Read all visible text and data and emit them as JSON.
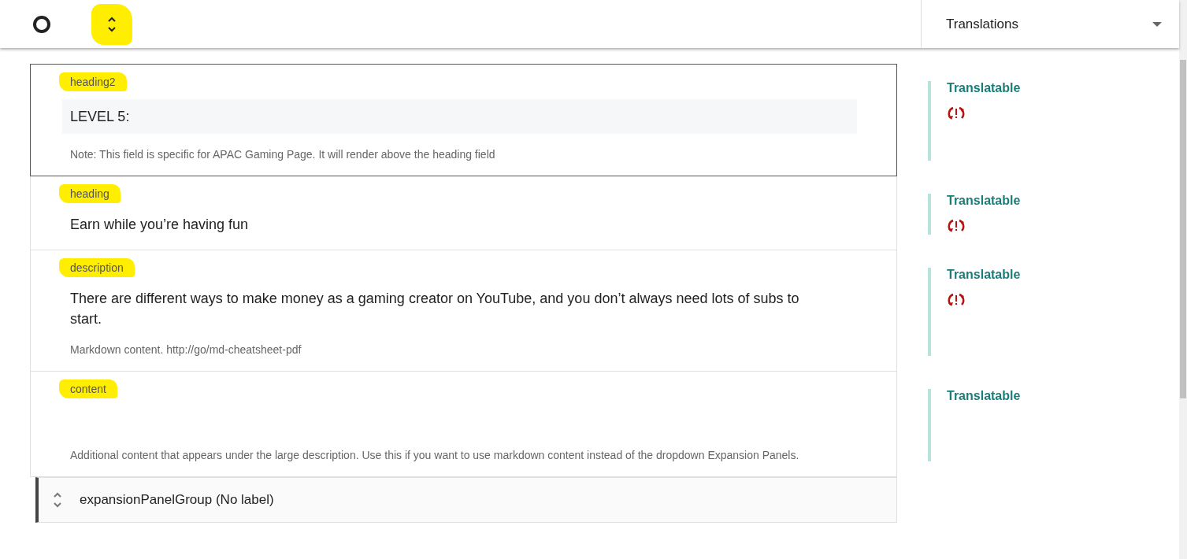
{
  "toolbar": {
    "highlighted": true,
    "dropdown": {
      "label": "Translations"
    }
  },
  "fields": [
    {
      "label": "heading2",
      "highlighted": true,
      "selected": true,
      "value": "LEVEL 5:",
      "note": "Note: This field is specific for APAC Gaming Page. It will render above the heading field",
      "translation": {
        "label": "Translatable",
        "warning": true
      }
    },
    {
      "label": "heading",
      "highlighted": true,
      "selected": false,
      "value": "Earn while you’re having fun",
      "translation": {
        "label": "Translatable",
        "warning": true
      }
    },
    {
      "label": "description",
      "highlighted": true,
      "selected": false,
      "value": "There are different ways to make money as a gaming creator on YouTube, and you don’t always need lots of subs to start.",
      "note": "Markdown content. http://go/md-cheatsheet-pdf",
      "translation": {
        "label": "Translatable",
        "warning": true
      }
    },
    {
      "label": "content",
      "highlighted": true,
      "selected": false,
      "note": "Additional content that appears under the large description. Use this if you want to use markdown content instead of the dropdown Expansion Panels.",
      "translation": {
        "label": "Translatable",
        "warning": false
      }
    }
  ],
  "group": {
    "label": "expansionPanelGroup (No label)"
  }
}
